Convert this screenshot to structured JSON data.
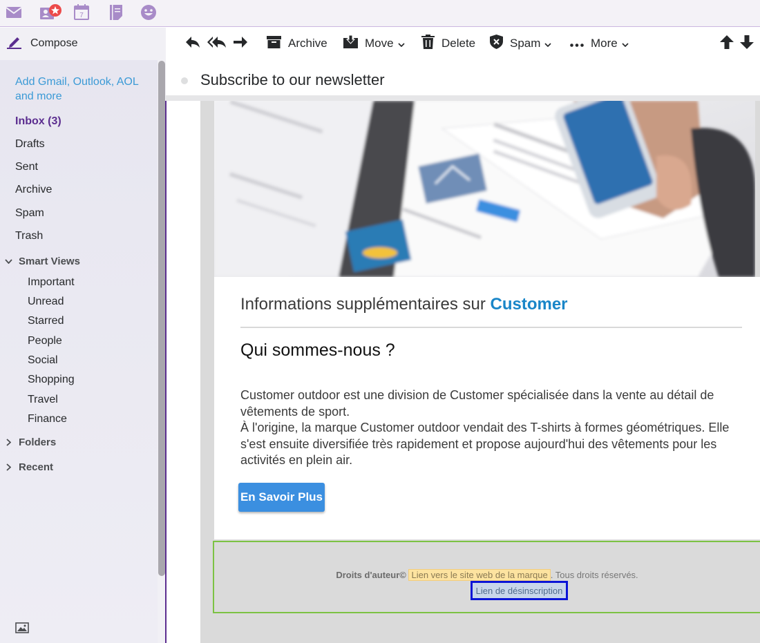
{
  "topbar": {
    "apps": [
      {
        "icon": "mail-icon"
      },
      {
        "icon": "contacts-icon"
      },
      {
        "icon": "calendar-icon",
        "day": "7"
      },
      {
        "icon": "notepad-icon"
      },
      {
        "icon": "messenger-icon"
      }
    ],
    "accent_color": "#7b5ea7"
  },
  "sidebar": {
    "compose_label": "Compose",
    "add_accounts": "Add Gmail, Outlook, AOL and more",
    "folders": [
      {
        "label": "Inbox (3)",
        "selected": true
      },
      {
        "label": "Drafts"
      },
      {
        "label": "Sent"
      },
      {
        "label": "Archive"
      },
      {
        "label": "Spam"
      },
      {
        "label": "Trash"
      }
    ],
    "smart_views": {
      "label": "Smart Views",
      "items": [
        "Important",
        "Unread",
        "Starred",
        "People",
        "Social",
        "Shopping",
        "Travel",
        "Finance"
      ]
    },
    "folders_section": "Folders",
    "recent_section": "Recent"
  },
  "toolbar": {
    "archive": "Archive",
    "move": "Move",
    "delete": "Delete",
    "spam": "Spam",
    "more": "More"
  },
  "message": {
    "subject": "Subscribe to our newsletter",
    "info_title_prefix": "Informations supplémentaires sur ",
    "info_title_brand": "Customer",
    "who_heading": "Qui sommes-nous ?",
    "paragraph_1": "Customer outdoor est une division de Customer spécialisée dans la vente au détail de vêtements de sport.",
    "paragraph_2": "À l'origine, la marque Customer outdoor vendait des T-shirts à formes géométriques. Elle s'est ensuite diversifiée très rapidement et propose aujourd'hui des vêtements pour les activités en plein air.",
    "cta": "En Savoir Plus",
    "footer": {
      "copyright": "Droits d'auteur©",
      "brand_link": "Lien vers le site web de la marque",
      "rights": ". Tous droits réservés.",
      "unsubscribe": "Lien de désinscription"
    },
    "brand_color": "#1a86c8",
    "cta_color": "#3b8fe0"
  }
}
